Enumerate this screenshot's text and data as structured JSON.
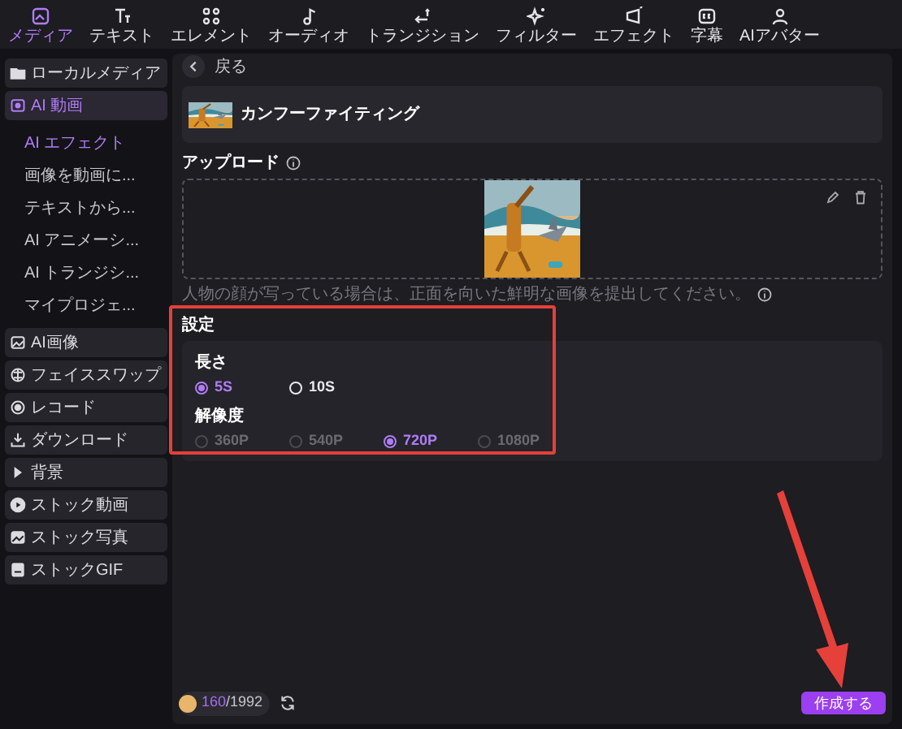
{
  "toolbar": {
    "tabs": [
      {
        "label": "メディア",
        "selected": true
      },
      {
        "label": "テキスト",
        "selected": false
      },
      {
        "label": "エレメント",
        "selected": false
      },
      {
        "label": "オーディオ",
        "selected": false
      },
      {
        "label": "トランジション",
        "selected": false
      },
      {
        "label": "フィルター",
        "selected": false
      },
      {
        "label": "エフェクト",
        "selected": false
      },
      {
        "label": "字幕",
        "selected": false
      },
      {
        "label": "AIアバター",
        "selected": false
      }
    ]
  },
  "sidebar": {
    "items": [
      {
        "label": "ローカルメディア",
        "selected": false
      },
      {
        "label": "AI 動画",
        "selected": true,
        "expanded": true,
        "children": [
          {
            "label": "AI エフェクト",
            "selected": true
          },
          {
            "label": "画像を動画に...",
            "selected": false
          },
          {
            "label": "テキストから...",
            "selected": false
          },
          {
            "label": "AI アニメーシ...",
            "selected": false
          },
          {
            "label": "AI トランジシ...",
            "selected": false
          },
          {
            "label": "マイプロジェ...",
            "selected": false
          }
        ]
      },
      {
        "label": "AI画像",
        "selected": false
      },
      {
        "label": "フェイススワップ",
        "selected": false
      },
      {
        "label": "レコード",
        "selected": false
      },
      {
        "label": "ダウンロード",
        "selected": false
      },
      {
        "label": "背景",
        "selected": false,
        "expanded": false
      },
      {
        "label": "ストック動画",
        "selected": false
      },
      {
        "label": "ストック写真",
        "selected": false
      },
      {
        "label": "ストックGIF",
        "selected": false
      }
    ]
  },
  "main": {
    "back": "戻る",
    "template": {
      "title": "カンフーファイティング"
    },
    "upload": {
      "label": "アップロード",
      "hint": "人物の顔が写っている場合は、正面を向いた鮮明な画像を提出してください。"
    },
    "settings": {
      "title": "設定",
      "groups": [
        {
          "label": "長さ",
          "options": [
            {
              "label": "5S",
              "selected": true,
              "disabled": false
            },
            {
              "label": "10S",
              "selected": false,
              "disabled": false
            }
          ]
        },
        {
          "label": "解像度",
          "options": [
            {
              "label": "360P",
              "selected": false,
              "disabled": true
            },
            {
              "label": "540P",
              "selected": false,
              "disabled": true
            },
            {
              "label": "720P",
              "selected": true,
              "disabled": false
            },
            {
              "label": "1080P",
              "selected": false,
              "disabled": true
            }
          ]
        }
      ]
    },
    "footer": {
      "credits_used": "160",
      "credits_total": "/1992",
      "create_button": "作成する"
    }
  }
}
